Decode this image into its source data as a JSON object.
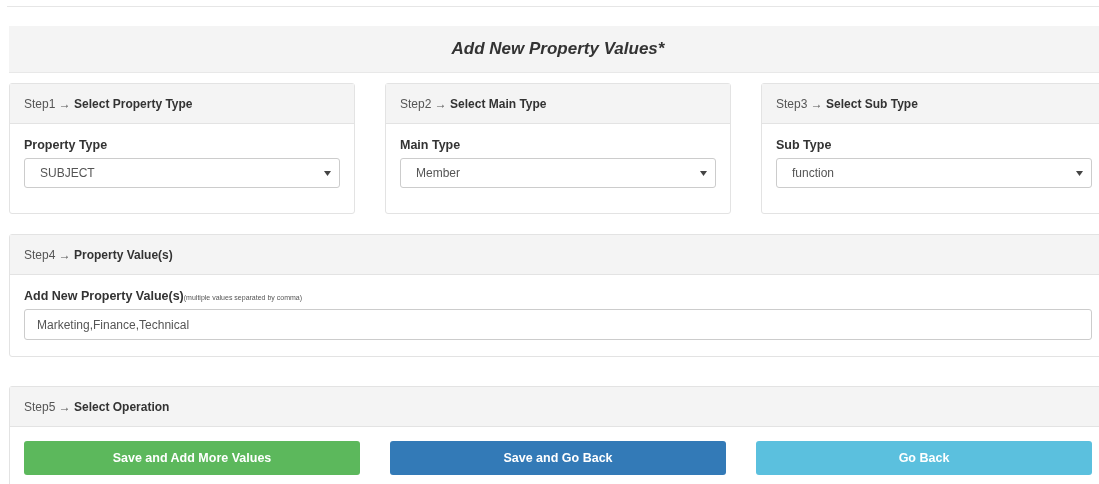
{
  "title": "Add New Property Values*",
  "steps": [
    {
      "header": "Step1 → **Select Property Type**",
      "label": "Property Type",
      "value": "SUBJECT"
    },
    {
      "header": "Step2 → **Select Main Type**",
      "label": "Main Type",
      "value": "Member"
    },
    {
      "header": "Step3 → **Select Sub Type**",
      "label": "Sub Type",
      "value": "function"
    }
  ],
  "values_panel": {
    "header": "Step4 → **Property Value(s)**",
    "label": "Add New Property Value(s)",
    "hint": "(multiple values separated by comma)",
    "value": "Marketing,Finance,Technical"
  },
  "operation_panel": {
    "header": "Step5 → **Select Operation**",
    "buttons": [
      {
        "label": "Save and Add More Values",
        "kind": "success"
      },
      {
        "label": "Save and Go Back",
        "kind": "primary"
      },
      {
        "label": "Go Back",
        "kind": "info"
      }
    ]
  }
}
